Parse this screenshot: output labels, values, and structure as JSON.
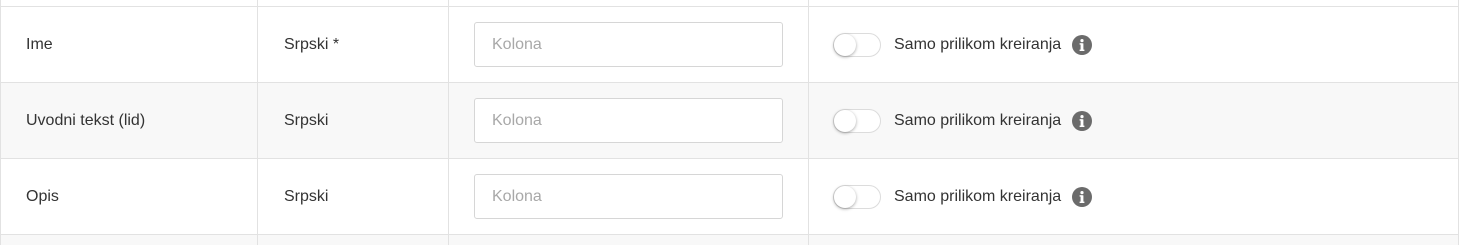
{
  "fields": [
    {
      "name": "Ime",
      "language": "Srpski *",
      "input_value": "",
      "input_placeholder": "Kolona",
      "toggle_on": false,
      "toggle_label": "Samo prilikom kreiranja",
      "info_icon": "info-icon"
    },
    {
      "name": "Uvodni tekst (lid)",
      "language": "Srpski",
      "input_value": "",
      "input_placeholder": "Kolona",
      "toggle_on": false,
      "toggle_label": "Samo prilikom kreiranja",
      "info_icon": "info-icon"
    },
    {
      "name": "Opis",
      "language": "Srpski",
      "input_value": "",
      "input_placeholder": "Kolona",
      "toggle_on": false,
      "toggle_label": "Samo prilikom kreiranja",
      "info_icon": "info-icon"
    }
  ],
  "colors": {
    "border": "#e2e2e2",
    "alt_row_bg": "#f8f8f8",
    "text": "#333333",
    "placeholder": "#a8a8a8",
    "info_icon_bg": "#6b6b6b"
  }
}
